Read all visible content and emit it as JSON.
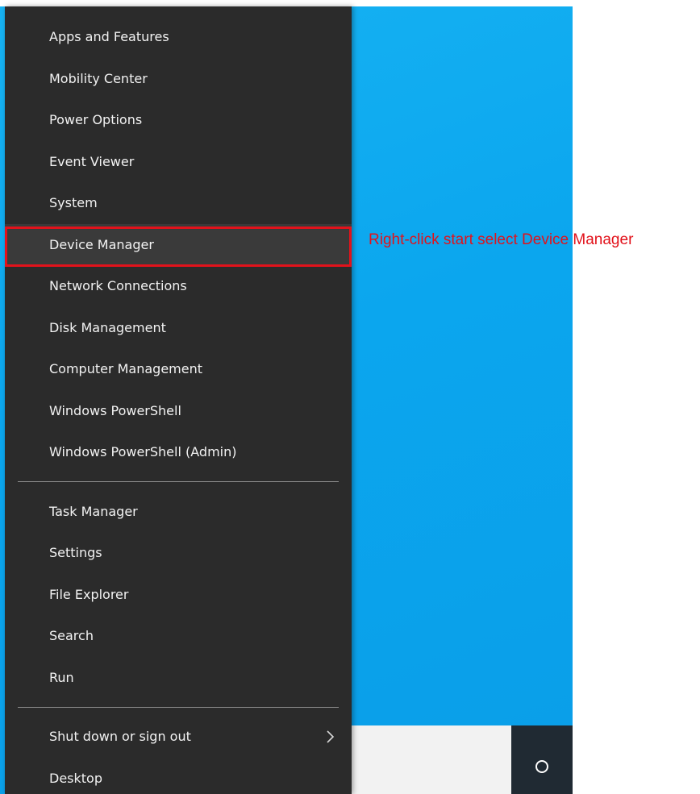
{
  "top_strip": {
    "faint_text": "Apps and Features"
  },
  "menu": {
    "group1": [
      {
        "label": "Apps and Features"
      },
      {
        "label": "Mobility Center"
      },
      {
        "label": "Power Options"
      },
      {
        "label": "Event Viewer"
      },
      {
        "label": "System"
      },
      {
        "label": "Device Manager"
      },
      {
        "label": "Network Connections"
      },
      {
        "label": "Disk Management"
      },
      {
        "label": "Computer Management"
      },
      {
        "label": "Windows PowerShell"
      },
      {
        "label": "Windows PowerShell (Admin)"
      }
    ],
    "group2": [
      {
        "label": "Task Manager"
      },
      {
        "label": "Settings"
      },
      {
        "label": "File Explorer"
      },
      {
        "label": "Search"
      },
      {
        "label": "Run"
      }
    ],
    "group3": [
      {
        "label": "Shut down or sign out",
        "submenu_icon": "chevron-right-icon"
      },
      {
        "label": "Desktop"
      }
    ],
    "highlighted_item": "Device Manager"
  },
  "annotation": {
    "text": "Right-click start select Device Manager",
    "color": "#e2121b"
  },
  "taskbar": {
    "cortana_icon": "cortana-ring-icon"
  },
  "colors": {
    "menu_background": "#2b2b2b",
    "menu_text": "#f2f2f2",
    "desktop_blue": "#0ba6ee"
  }
}
